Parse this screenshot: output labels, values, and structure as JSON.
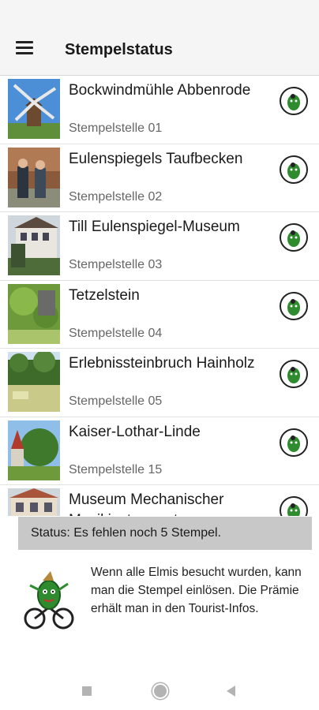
{
  "app_bar": {
    "title": "Stempelstatus",
    "menu_icon": "hamburger-menu-icon"
  },
  "stations": [
    {
      "name": "Bockwindmühle Abbenrode",
      "subtitle": "Stempelstelle 01",
      "thumb": "windmill"
    },
    {
      "name": "Eulenspiegels Taufbecken",
      "subtitle": "Stempelstelle 02",
      "thumb": "people"
    },
    {
      "name": "Till Eulenspiegel-Museum",
      "subtitle": "Stempelstelle 03",
      "thumb": "museum"
    },
    {
      "name": "Tetzelstein",
      "subtitle": "Stempelstelle 04",
      "thumb": "forest"
    },
    {
      "name": "Erlebnissteinbruch Hainholz",
      "subtitle": "Stempelstelle 05",
      "thumb": "meadow"
    },
    {
      "name": "Kaiser-Lothar-Linde",
      "subtitle": "Stempelstelle 15",
      "thumb": "church"
    },
    {
      "name": "Museum Mechanischer Musikinstrumente",
      "subtitle": "",
      "thumb": "house"
    }
  ],
  "stamp_icon": "elmi-stamp-icon",
  "status_text": "Status: Es fehlen noch 5 Stempel.",
  "info_text": "Wenn alle Elmis besucht wurden, kann man die Stempel einlösen. Die Prämie erhält man in den Tourist-Infos.",
  "navigation": {
    "back": "square-nav-icon",
    "home": "circle-nav-icon",
    "recent": "triangle-nav-icon"
  },
  "colors": {
    "appbar": "#f5f5f5",
    "status_bar": "#c8c8c8",
    "stamp_green": "#2e8b2e"
  }
}
